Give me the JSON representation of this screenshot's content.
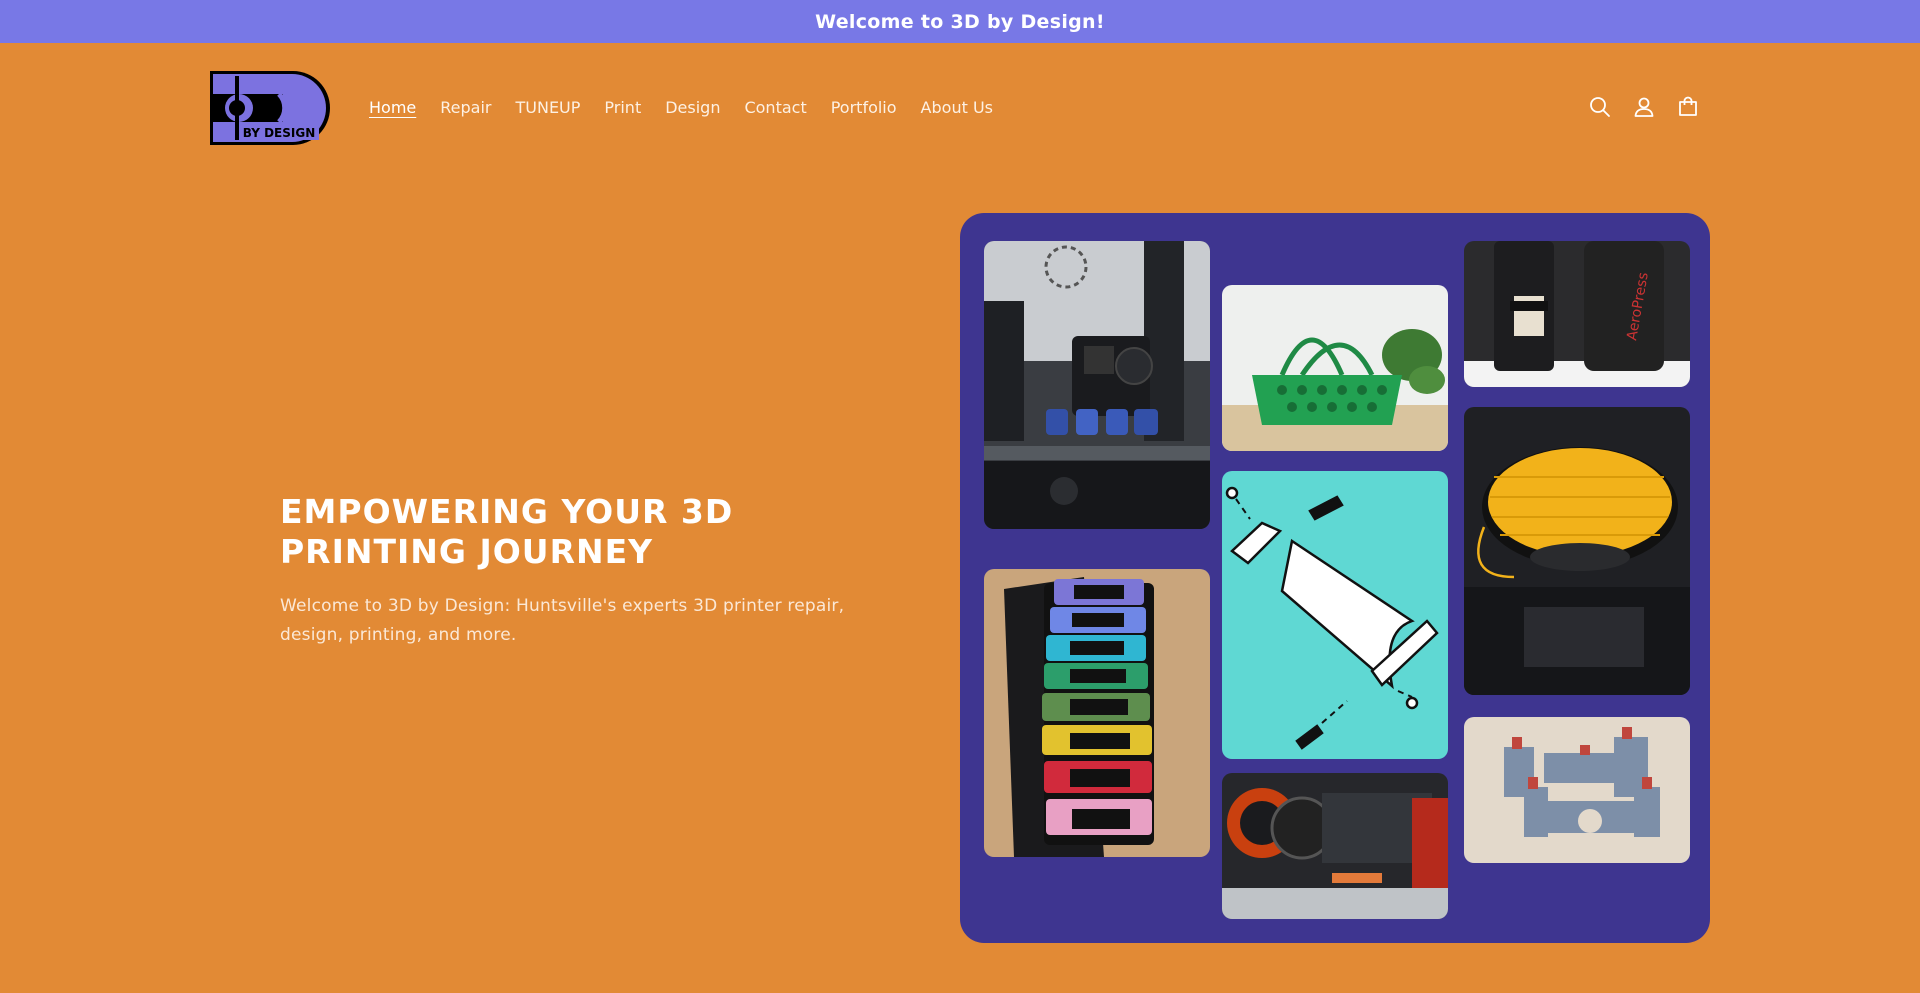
{
  "announcement": {
    "text": "Welcome to 3D by Design!"
  },
  "header": {
    "logo_text": "BY DESIGN",
    "nav": [
      {
        "label": "Home",
        "active": true
      },
      {
        "label": "Repair"
      },
      {
        "label": "TUNEUP"
      },
      {
        "label": "Print"
      },
      {
        "label": "Design"
      },
      {
        "label": "Contact"
      },
      {
        "label": "Portfolio"
      },
      {
        "label": "About Us"
      }
    ],
    "icons": [
      "search-icon",
      "account-icon",
      "cart-icon"
    ]
  },
  "hero": {
    "title": "EMPOWERING YOUR 3D PRINTING JOURNEY",
    "subtitle": "Welcome to 3D by Design: Huntsville's experts 3D printer repair, design, printing, and more."
  },
  "gallery": {
    "images": [
      "3d-printer-printing-blue-parts",
      "green-printed-basket",
      "aeropress-parts",
      "feet-spacers-rainbow",
      "hammock-assembly-diagram",
      "yellow-filament-spool",
      "printer-hotend-closeup",
      "gray-printed-castle"
    ],
    "aeropress_text": "AeroPress"
  },
  "colors": {
    "page_bg": "#E28A35",
    "announcement_bg": "#7878E6",
    "gallery_bg": "#3E3590"
  }
}
